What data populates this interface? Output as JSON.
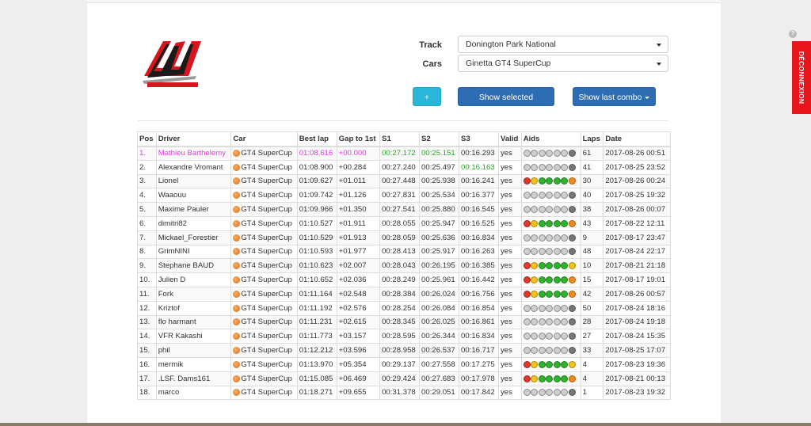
{
  "form": {
    "track_label": "Track",
    "track_value": "Donington Park National",
    "cars_label": "Cars",
    "cars_value": "Ginetta GT4 SuperCup"
  },
  "buttons": {
    "add_label": "+",
    "show_selected_label": "Show selected",
    "show_last_combo_label": "Show last combo"
  },
  "side": {
    "logout_label": "DÉCONNEXION",
    "help_label": "?"
  },
  "table": {
    "headers": [
      "Pos",
      "Driver",
      "Car",
      "Best lap",
      "Gap to 1st",
      "S1",
      "S2",
      "S3",
      "Valid",
      "Aids",
      "Laps",
      "Date"
    ],
    "rows": [
      {
        "pos": "1.",
        "driver": "Mathieu Barthelemy",
        "car": "GT4 SuperCup",
        "best": "01:08.616",
        "gap": "+00.000",
        "s1": "00:27.172",
        "s2": "00:25.151",
        "s3": "00:16.293",
        "valid": "yes",
        "laps": "61",
        "date": "2017-08-26 00:51"
      },
      {
        "pos": "2.",
        "driver": "Alexandre Vromant",
        "car": "GT4 SuperCup",
        "best": "01:08.900",
        "gap": "+00.284",
        "s1": "00:27.240",
        "s2": "00:25.497",
        "s3": "00:16.163",
        "valid": "yes",
        "laps": "41",
        "date": "2017-08-25 23:52"
      },
      {
        "pos": "3.",
        "driver": "Lionel",
        "car": "GT4 SuperCup",
        "best": "01:09.627",
        "gap": "+01.011",
        "s1": "00:27.448",
        "s2": "00:25.938",
        "s3": "00:16.241",
        "valid": "yes",
        "laps": "30",
        "date": "2017-08-26 00:24"
      },
      {
        "pos": "4.",
        "driver": "Waaouu",
        "car": "GT4 SuperCup",
        "best": "01:09.742",
        "gap": "+01.126",
        "s1": "00:27.831",
        "s2": "00:25.534",
        "s3": "00:16.377",
        "valid": "yes",
        "laps": "40",
        "date": "2017-08-25 19:32"
      },
      {
        "pos": "5.",
        "driver": "Maxime Pauler",
        "car": "GT4 SuperCup",
        "best": "01:09.966",
        "gap": "+01.350",
        "s1": "00:27.541",
        "s2": "00:25.880",
        "s3": "00:16.545",
        "valid": "yes",
        "laps": "38",
        "date": "2017-08-26 00:07"
      },
      {
        "pos": "6.",
        "driver": "dimitri82",
        "car": "GT4 SuperCup",
        "best": "01:10.527",
        "gap": "+01.911",
        "s1": "00:28.055",
        "s2": "00:25.947",
        "s3": "00:16.525",
        "valid": "yes",
        "laps": "43",
        "date": "2017-08-22 12:11"
      },
      {
        "pos": "7.",
        "driver": "Mickael_Forestier",
        "car": "GT4 SuperCup",
        "best": "01:10.529",
        "gap": "+01.913",
        "s1": "00:28.059",
        "s2": "00:25.636",
        "s3": "00:16.834",
        "valid": "yes",
        "laps": "9",
        "date": "2017-08-17 23:47"
      },
      {
        "pos": "8.",
        "driver": "GrimNINI",
        "car": "GT4 SuperCup",
        "best": "01:10.593",
        "gap": "+01.977",
        "s1": "00:28.413",
        "s2": "00:25.917",
        "s3": "00:16.263",
        "valid": "yes",
        "laps": "48",
        "date": "2017-08-24 22:17"
      },
      {
        "pos": "9.",
        "driver": "Stephane BAUD",
        "car": "GT4 SuperCup",
        "best": "01:10.623",
        "gap": "+02.007",
        "s1": "00:28.043",
        "s2": "00:26.195",
        "s3": "00:16.385",
        "valid": "yes",
        "laps": "10",
        "date": "2017-08-21 21:18"
      },
      {
        "pos": "10.",
        "driver": "Julien D",
        "car": "GT4 SuperCup",
        "best": "01:10.652",
        "gap": "+02.036",
        "s1": "00:28.249",
        "s2": "00:25.961",
        "s3": "00:16.442",
        "valid": "yes",
        "laps": "15",
        "date": "2017-08-17 19:01"
      },
      {
        "pos": "11.",
        "driver": "Fork",
        "car": "GT4 SuperCup",
        "best": "01:11.164",
        "gap": "+02.548",
        "s1": "00:28.384",
        "s2": "00:26.024",
        "s3": "00:16.756",
        "valid": "yes",
        "laps": "42",
        "date": "2017-08-26 00:57"
      },
      {
        "pos": "12.",
        "driver": "Kriztof",
        "car": "GT4 SuperCup",
        "best": "01:11.192",
        "gap": "+02.576",
        "s1": "00:28.254",
        "s2": "00:26.084",
        "s3": "00:16.854",
        "valid": "yes",
        "laps": "50",
        "date": "2017-08-24 18:16"
      },
      {
        "pos": "13.",
        "driver": "flo harmant",
        "car": "GT4 SuperCup",
        "best": "01:11.231",
        "gap": "+02.615",
        "s1": "00:28.345",
        "s2": "00:26.025",
        "s3": "00:16.861",
        "valid": "yes",
        "laps": "28",
        "date": "2017-08-24 19:18"
      },
      {
        "pos": "14.",
        "driver": "VFR Kakashi",
        "car": "GT4 SuperCup",
        "best": "01:11.773",
        "gap": "+03.157",
        "s1": "00:28.595",
        "s2": "00:26.344",
        "s3": "00:16.834",
        "valid": "yes",
        "laps": "27",
        "date": "2017-08-24 15:35"
      },
      {
        "pos": "15.",
        "driver": "phil",
        "car": "GT4 SuperCup",
        "best": "01:12.212",
        "gap": "+03.596",
        "s1": "00:28.958",
        "s2": "00:26.537",
        "s3": "00:16.717",
        "valid": "yes",
        "laps": "33",
        "date": "2017-08-25 17:07"
      },
      {
        "pos": "16.",
        "driver": "mermik",
        "car": "GT4 SuperCup",
        "best": "01:13.970",
        "gap": "+05.354",
        "s1": "00:29.137",
        "s2": "00:27.558",
        "s3": "00:17.275",
        "valid": "yes",
        "laps": "4",
        "date": "2017-08-23 19:36"
      },
      {
        "pos": "17.",
        "driver": ".LSF. Dams161",
        "car": "GT4 SuperCup",
        "best": "01:15.085",
        "gap": "+06.469",
        "s1": "00:29.424",
        "s2": "00:27.683",
        "s3": "00:17.978",
        "valid": "yes",
        "laps": "4",
        "date": "2017-08-21 00:13"
      },
      {
        "pos": "18.",
        "driver": "marco",
        "car": "GT4 SuperCup",
        "best": "01:18.271",
        "gap": "+09.655",
        "s1": "00:31.378",
        "s2": "00:29.051",
        "s3": "00:17.842",
        "valid": "yes",
        "laps": "1",
        "date": "2017-08-23 19:32"
      }
    ]
  }
}
